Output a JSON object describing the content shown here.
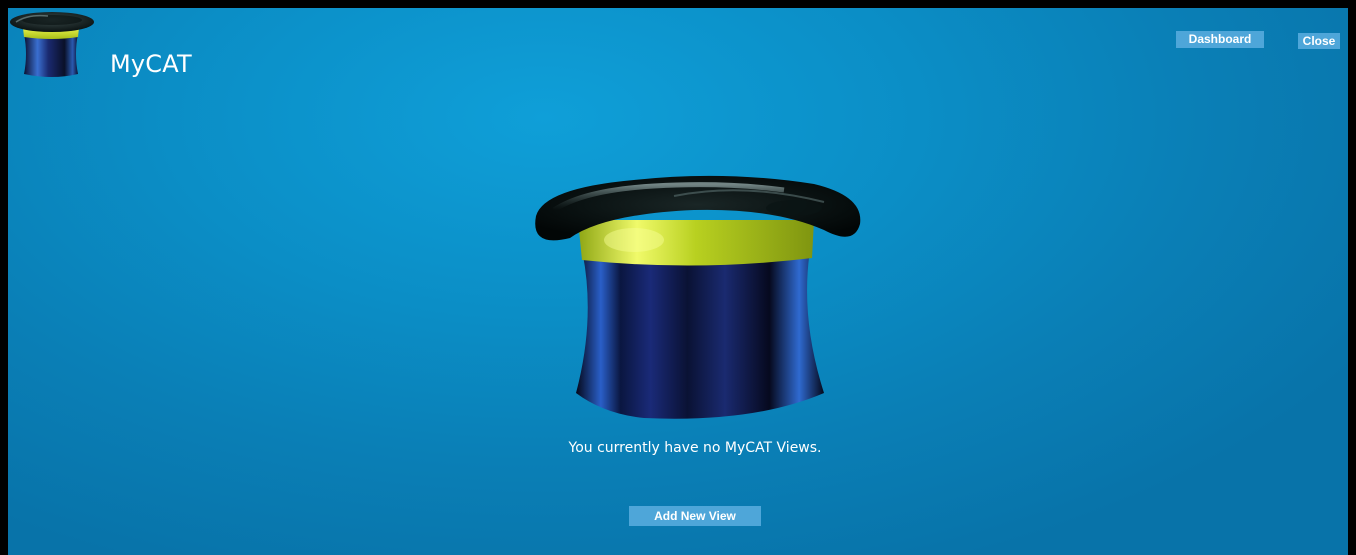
{
  "app": {
    "title": "MyCAT",
    "logo_icon": "top-hat-icon"
  },
  "header": {
    "dashboard_label": "Dashboard",
    "close_label": "Close"
  },
  "main": {
    "hero_icon": "top-hat-icon",
    "empty_message": "You currently have no MyCAT Views.",
    "add_view_label": "Add New View"
  },
  "colors": {
    "background": "#0b8ec6",
    "button": "#4ea6d9",
    "hat_band": "#c8e020",
    "hat_body": "#1a2a6a"
  }
}
